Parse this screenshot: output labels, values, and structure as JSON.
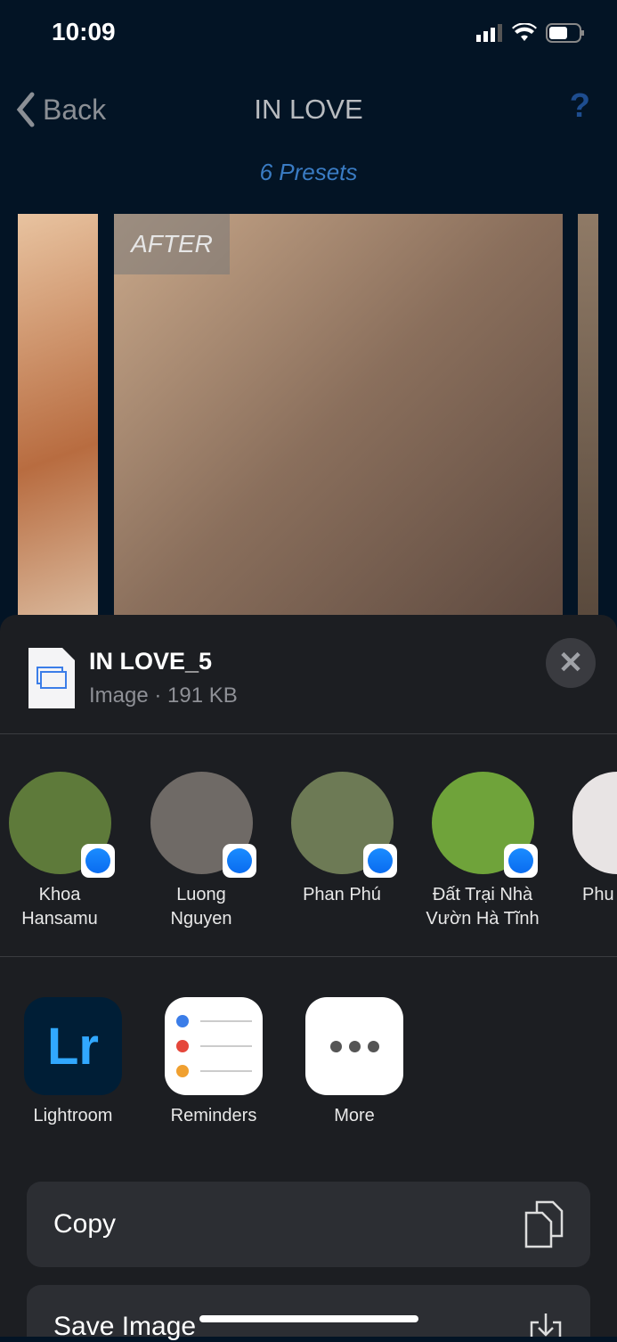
{
  "status_bar": {
    "time": "10:09"
  },
  "nav": {
    "back_label": "Back",
    "title": "IN LOVE",
    "help": "?",
    "subtitle": "6 Presets"
  },
  "carousel": {
    "after_label": "AFTER"
  },
  "share": {
    "file_name": "IN LOVE_5",
    "file_meta": "Image · 191 KB",
    "contacts": [
      {
        "line1": "Khoa",
        "line2": "Hansamu",
        "color": "#5e7a3a"
      },
      {
        "line1": "Luong",
        "line2": "Nguyen",
        "color": "#6f6a66"
      },
      {
        "line1": "Phan Phú",
        "line2": "",
        "color": "#6d7a55"
      },
      {
        "line1": "Đất Trại Nhà",
        "line2": "Vườn Hà Tĩnh",
        "color": "#6fa33a"
      },
      {
        "line1": "Phu",
        "line2": "",
        "color": "#e8e4e4"
      }
    ],
    "apps": [
      {
        "label": "Lightroom",
        "glyph": "Lr"
      },
      {
        "label": "Reminders"
      },
      {
        "label": "More"
      }
    ],
    "actions": [
      {
        "label": "Copy",
        "icon": "copy-icon"
      },
      {
        "label": "Save Image",
        "icon": "save-icon"
      }
    ]
  }
}
